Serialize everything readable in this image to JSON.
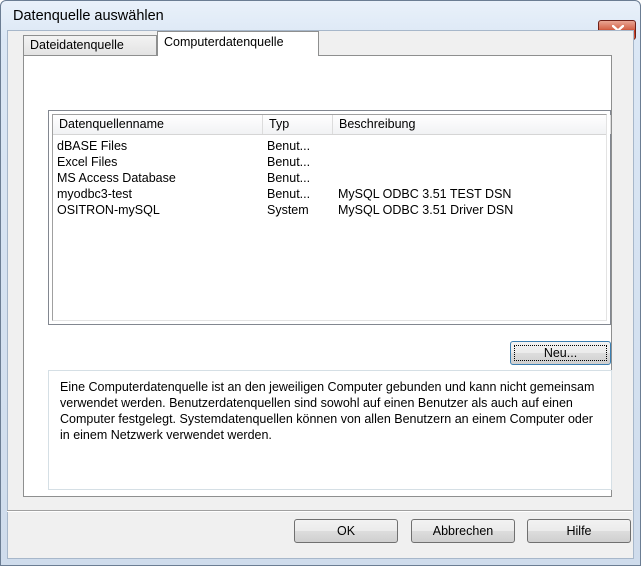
{
  "window": {
    "title": "Datenquelle auswählen"
  },
  "tabs": [
    {
      "label": "Dateidatenquelle",
      "active": false
    },
    {
      "label": "Computerdatenquelle",
      "active": true
    }
  ],
  "list": {
    "columns": [
      "Datenquellenname",
      "Typ",
      "Beschreibung"
    ],
    "rows": [
      {
        "name": "dBASE Files",
        "type": "Benut...",
        "description": ""
      },
      {
        "name": "Excel Files",
        "type": "Benut...",
        "description": ""
      },
      {
        "name": "MS Access Database",
        "type": "Benut...",
        "description": ""
      },
      {
        "name": "myodbc3-test",
        "type": "Benut...",
        "description": "MySQL ODBC 3.51 TEST DSN"
      },
      {
        "name": "OSITRON-mySQL",
        "type": "System",
        "description": "MySQL ODBC 3.51 Driver DSN"
      }
    ]
  },
  "buttons": {
    "new": "Neu...",
    "ok": "OK",
    "cancel": "Abbrechen",
    "help": "Hilfe"
  },
  "description": "Eine Computerdatenquelle ist an den jeweiligen Computer gebunden und kann nicht gemeinsam verwendet werden. Benutzerdatenquellen sind sowohl auf einen Benutzer als auch auf einen Computer festgelegt. Systemdatenquellen können von allen Benutzern an einem Computer oder in einem Netzwerk verwendet werden.",
  "icons": {
    "close": "close-icon"
  },
  "colors": {
    "close_button": "#c2361d",
    "focus_border": "#3c7fb1"
  }
}
